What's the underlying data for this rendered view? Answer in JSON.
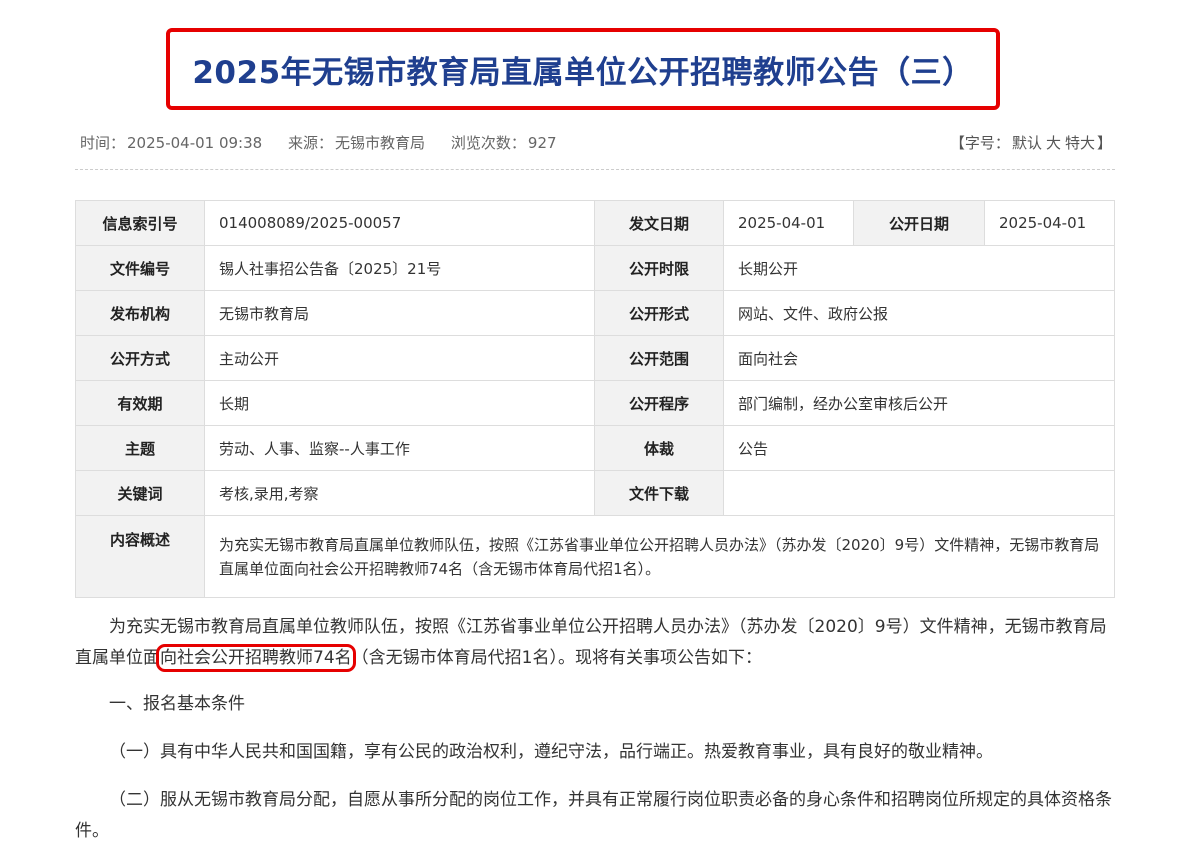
{
  "title": "2025年无锡市教育局直属单位公开招聘教师公告（三）",
  "meta": {
    "time_label": "时间：",
    "time": "2025-04-01 09:38",
    "source_label": "来源：",
    "source": "无锡市教育局",
    "views_label": "浏览次数：",
    "views": "927",
    "font_open": "【字号：",
    "font_default": "默认",
    "font_large": "大",
    "font_xlarge": "特大",
    "font_close": "】"
  },
  "info": {
    "index_label": "信息索引号",
    "index": "014008089/2025-00057",
    "issue_date_label": "发文日期",
    "issue_date": "2025-04-01",
    "public_date_label": "公开日期",
    "public_date": "2025-04-01",
    "doc_no_label": "文件编号",
    "doc_no": "锡人社事招公告备〔2025〕21号",
    "period_label": "公开时限",
    "period": "长期公开",
    "publisher_label": "发布机构",
    "publisher": "无锡市教育局",
    "form_label": "公开形式",
    "form": "网站、文件、政府公报",
    "method_label": "公开方式",
    "method": "主动公开",
    "scope_label": "公开范围",
    "scope": "面向社会",
    "validity_label": "有效期",
    "validity": "长期",
    "procedure_label": "公开程序",
    "procedure": "部门编制，经办公室审核后公开",
    "topic_label": "主题",
    "topic": "劳动、人事、监察--人事工作",
    "genre_label": "体裁",
    "genre": "公告",
    "keywords_label": "关键词",
    "keywords": "考核,录用,考察",
    "download_label": "文件下载",
    "download": "",
    "summary_label": "内容概述",
    "summary": "为充实无锡市教育局直属单位教师队伍，按照《江苏省事业单位公开招聘人员办法》（苏办发〔2020〕9号）文件精神，无锡市教育局直属单位面向社会公开招聘教师74名（含无锡市体育局代招1名）。"
  },
  "body": {
    "p1_a": "为充实无锡市教育局直属单位教师队伍，按照《江苏省事业单位公开招聘人员办法》（苏办发〔2020〕9号）文件精神，无锡市教育局直属单位面",
    "p1_hl": "向社会公开招聘教师74名",
    "p1_b": "（含无锡市体育局代招1名）。现将有关事项公告如下：",
    "section1": "一、报名基本条件",
    "item1": "（一）具有中华人民共和国国籍，享有公民的政治权利，遵纪守法，品行端正。热爱教育事业，具有良好的敬业精神。",
    "item2": "（二）服从无锡市教育局分配，自愿从事所分配的岗位工作，并具有正常履行岗位职责必备的身心条件和招聘岗位所规定的具体资格条件。"
  }
}
